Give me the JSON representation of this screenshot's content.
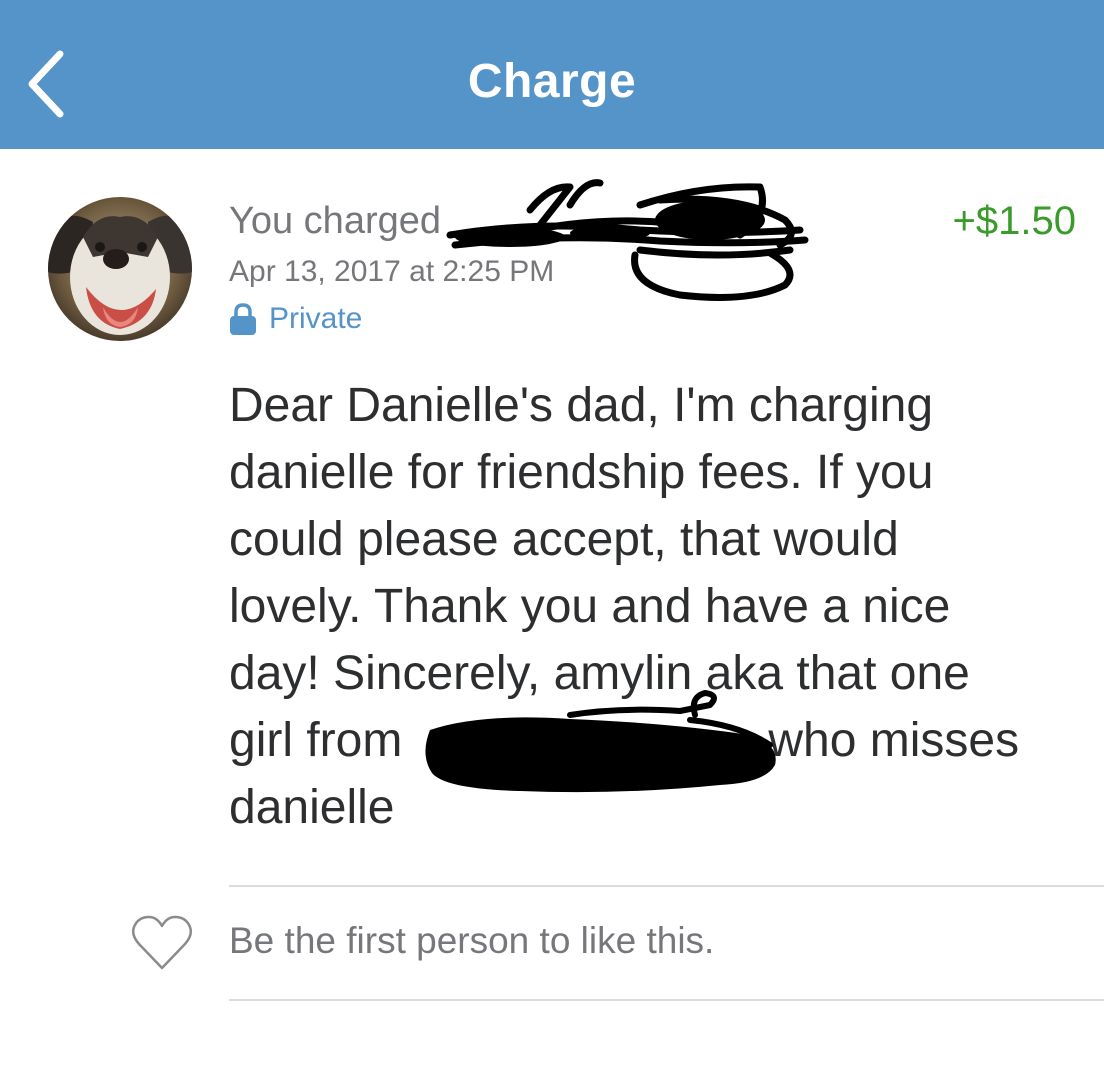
{
  "nav": {
    "title": "Charge",
    "back_icon": "chevron-left-icon",
    "background": "#5494c9"
  },
  "transaction": {
    "headline": "You charged",
    "timestamp": "Apr 13, 2017 at 2:25 PM",
    "privacy_icon": "lock-icon",
    "privacy_label": "Private",
    "amount": "+$1.50",
    "amount_color": "#3b9a2c",
    "note_lines": [
      "Dear Danielle's dad, I'm charging",
      "danielle for friendship fees. If you",
      "could please accept, that would",
      "lovely. Thank you and have a nice",
      "day! Sincerely, amylin aka that one",
      "girl from",
      "danielle"
    ],
    "note_line_6_suffix": "who misses"
  },
  "likes": {
    "icon": "heart-outline-icon",
    "text": "Be the first person to like this."
  }
}
